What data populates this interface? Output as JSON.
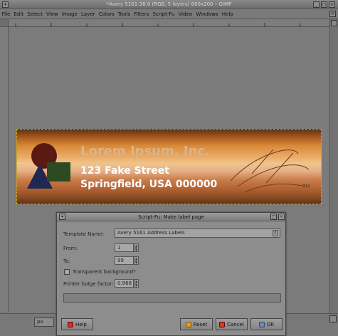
{
  "window": {
    "title": "*Avery 5161-38.0 (RGB, 5 layers) 800x200 – GIMP"
  },
  "menubar": {
    "items": [
      "File",
      "Edit",
      "Select",
      "View",
      "Image",
      "Layer",
      "Colors",
      "Tools",
      "Filters",
      "Script-Fu",
      "Video",
      "Windows",
      "Help"
    ]
  },
  "image": {
    "company": "Lorem Ipsum, Inc.",
    "address_line1": "123 Fake Street",
    "address_line2": "Springfield, USA 000000",
    "tm": "TM"
  },
  "statusbar": {
    "unit": "px"
  },
  "dialog": {
    "title": "Script-Fu: Make label page",
    "template_label": "Template Name:",
    "template_value": "Avery  5161 Address Labels",
    "from_label": "From:",
    "from_value": "1",
    "to_label": "To:",
    "to_value": "99",
    "transparent_label": "Transparent background?",
    "fudge_label": "Printer fudge factor:",
    "fudge_value": "0.968",
    "buttons": {
      "help": "Help",
      "reset": "Reset",
      "cancel": "Cancel",
      "ok": "OK"
    }
  },
  "colors": {
    "selection": "#d0b000",
    "company_text": "#d9b48a",
    "address_text": "#ffffff"
  }
}
